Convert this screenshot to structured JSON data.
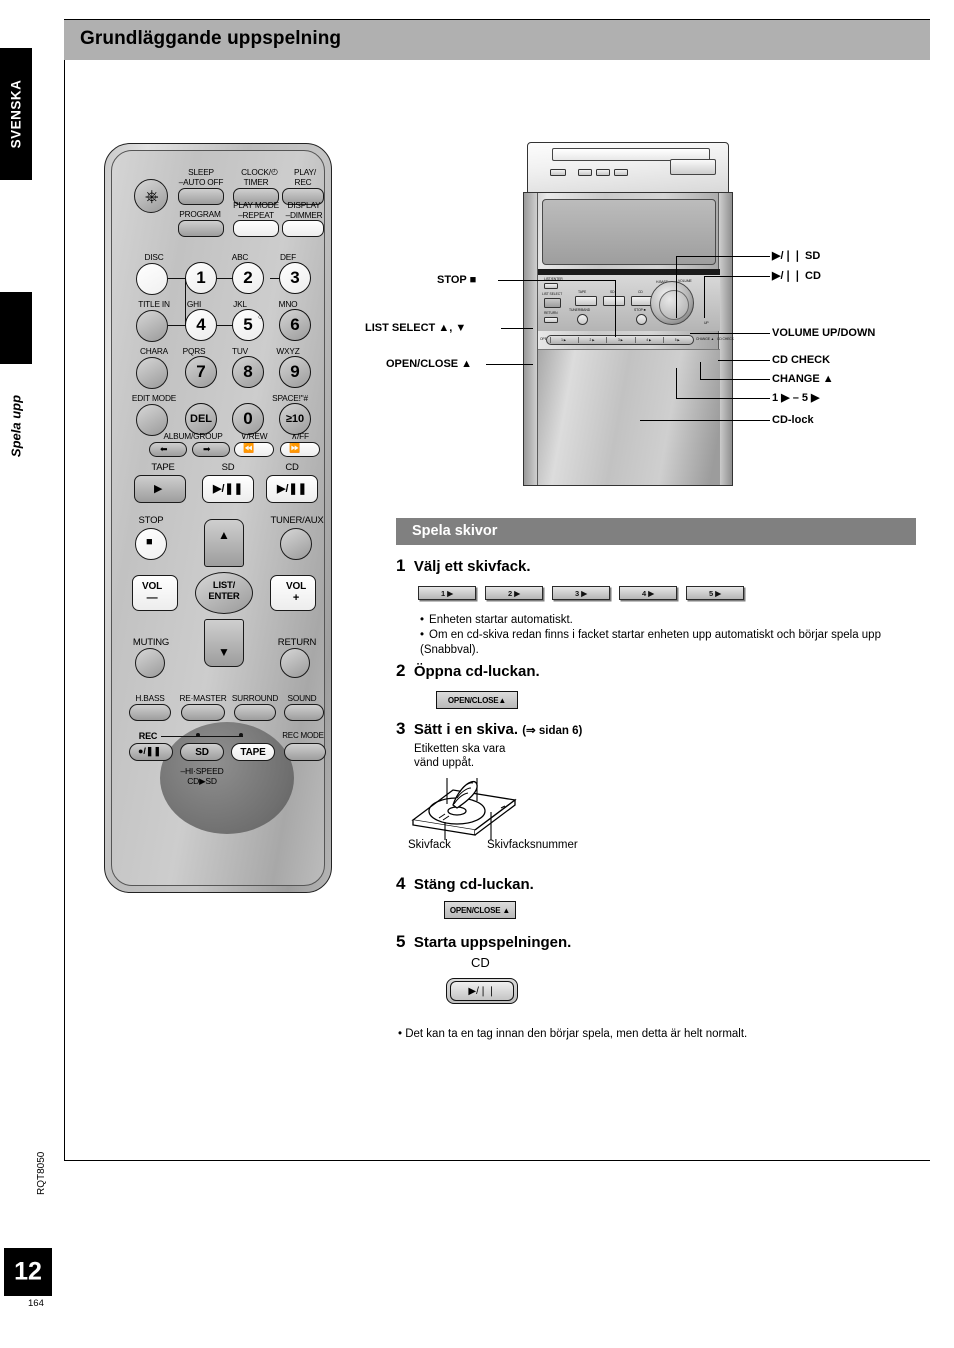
{
  "page": {
    "header_title": "Grundläggande uppspelning",
    "language_tab": "SVENSKA",
    "section_tab": "Spela upp",
    "page_number": "12",
    "sub_page_number": "164",
    "doc_code": "RQT8050"
  },
  "remote": {
    "power_icon": "power-icon",
    "top_buttons": [
      {
        "label_top": "SLEEP",
        "label_bottom": "–AUTO OFF"
      },
      {
        "label_top": "CLOCK/",
        "label_bottom": "TIMER"
      },
      {
        "label_top": "PLAY/",
        "label_bottom": "REC",
        "icon": "clock-icon"
      }
    ],
    "second_row": [
      {
        "label": "PROGRAM"
      },
      {
        "label_top": "PLAY MODE",
        "label_bottom": "–REPEAT"
      },
      {
        "label_top": "DISPLAY",
        "label_bottom": "–DIMMER"
      }
    ],
    "left_column": [
      "DISC",
      "TITLE IN",
      "CHARA",
      "EDIT MODE"
    ],
    "keypad": [
      {
        "key": "1",
        "letters": ""
      },
      {
        "key": "2",
        "letters": "ABC"
      },
      {
        "key": "3",
        "letters": "DEF"
      },
      {
        "key": "4",
        "letters": "GHI"
      },
      {
        "key": "5",
        "letters": "JKL"
      },
      {
        "key": "6",
        "letters": "MNO"
      },
      {
        "key": "7",
        "letters": "PQRS"
      },
      {
        "key": "8",
        "letters": "TUV"
      },
      {
        "key": "9",
        "letters": "WXYZ"
      },
      {
        "key": "DEL",
        "letters": ""
      },
      {
        "key": "0",
        "letters": ""
      },
      {
        "key": "≥10",
        "letters": "SPACE!\"#"
      }
    ],
    "skip_row": {
      "album_group_label": "ALBUM/GROUP",
      "rew_label": "∨/REW",
      "ff_label": "∧/FF",
      "prev_glyph": "◀◀",
      "next_glyph": "▶▶"
    },
    "source_row": [
      {
        "label": "TAPE",
        "glyph": "▶"
      },
      {
        "label": "SD",
        "glyph": "▶/❘❘"
      },
      {
        "label": "CD",
        "glyph": "▶/❘❘"
      }
    ],
    "nav": {
      "stop_label": "STOP",
      "stop_glyph": "■",
      "tuner_label": "TUNER/AUX",
      "up_glyph": "▲",
      "down_glyph": "▼",
      "center_line1": "LIST/",
      "center_line2": "ENTER",
      "vol_minus_line1": "VOL",
      "vol_minus_line2": "—",
      "vol_plus_line1": "VOL",
      "vol_plus_line2": "+",
      "muting_label": "MUTING",
      "return_label": "RETURN"
    },
    "sound_row": [
      "H.BASS",
      "RE·MASTER",
      "SURROUND",
      "SOUND"
    ],
    "rec_row": {
      "rec_label": "REC",
      "rec_glyph": "●/❘❘",
      "sd_label": "SD",
      "tape_label": "TAPE",
      "rec_mode_label": "REC MODE",
      "hispeed_line1": "–HI·SPEED",
      "hispeed_line2": "CD▶SD"
    }
  },
  "stereo": {
    "callouts_left": [
      {
        "text": "STOP ■"
      },
      {
        "text": "LIST SELECT ▲, ▼"
      },
      {
        "text": "OPEN/CLOSE ▲"
      }
    ],
    "callouts_right": [
      {
        "text": "▶/❘❘ SD"
      },
      {
        "text": "▶/❘❘ CD"
      },
      {
        "text": "VOLUME UP/DOWN"
      },
      {
        "text": "CD CHECK"
      },
      {
        "text": "CHANGE ▲"
      },
      {
        "text": "1 ▶ – 5 ▶"
      },
      {
        "text": "CD-lock"
      }
    ],
    "panel_labels": {
      "list_enter": "LIST/ENTER",
      "list_select": "LIST SELECT",
      "return": "RETURN",
      "open_close": "OPEN/CLOSE",
      "tape": "TAPE",
      "sd": "SD",
      "cd": "CD",
      "tuner_band": "TUNER/BAND",
      "stop": "STOP ■",
      "hbass": "H.BASS",
      "volume": "VOLUME",
      "down": "DOWN",
      "up": "UP",
      "change": "CHANGE ▲",
      "cd_check": "CD CHECK"
    },
    "tray_cells": [
      "1 ▶",
      "2 ▶",
      "3 ▶",
      "4 ▶",
      "5 ▶"
    ]
  },
  "instructions": {
    "section_title": "Spela skivor",
    "steps": [
      {
        "num": "1",
        "text": "Välj ett skivfack."
      },
      {
        "num": "2",
        "text": "Öppna cd-luckan."
      },
      {
        "num": "3",
        "text": "Sätt i en skiva.",
        "ref": "(⇒ sidan 6)"
      },
      {
        "num": "4",
        "text": "Stäng cd-luckan."
      },
      {
        "num": "5",
        "text": "Starta uppspelningen."
      }
    ],
    "disc_buttons": [
      "1 ▶",
      "2 ▶",
      "3 ▶",
      "4 ▶",
      "5 ▶"
    ],
    "step1_bullets": [
      "Enheten startar automatiskt.",
      "Om en cd-skiva redan finns i facket startar enheten upp automatiskt och börjar spela upp (Snabbval)."
    ],
    "open_close_button": "OPEN/CLOSE▲",
    "open_close_button2": "OPEN/CLOSE ▲",
    "disc_diagram": {
      "note_line1": "Etiketten ska vara",
      "note_line2": "vänd uppåt.",
      "label_left": "Skivfack",
      "label_right": "Skivfacksnummer"
    },
    "cd_label": "CD",
    "play_pause_glyph": "▶/❘❘",
    "final_note": "• Det kan ta en tag innan den börjar spela, men detta är helt normalt."
  },
  "colors": {
    "header_band": "#b0b0b0",
    "section_bar": "#808080",
    "tab_black": "#000000"
  }
}
